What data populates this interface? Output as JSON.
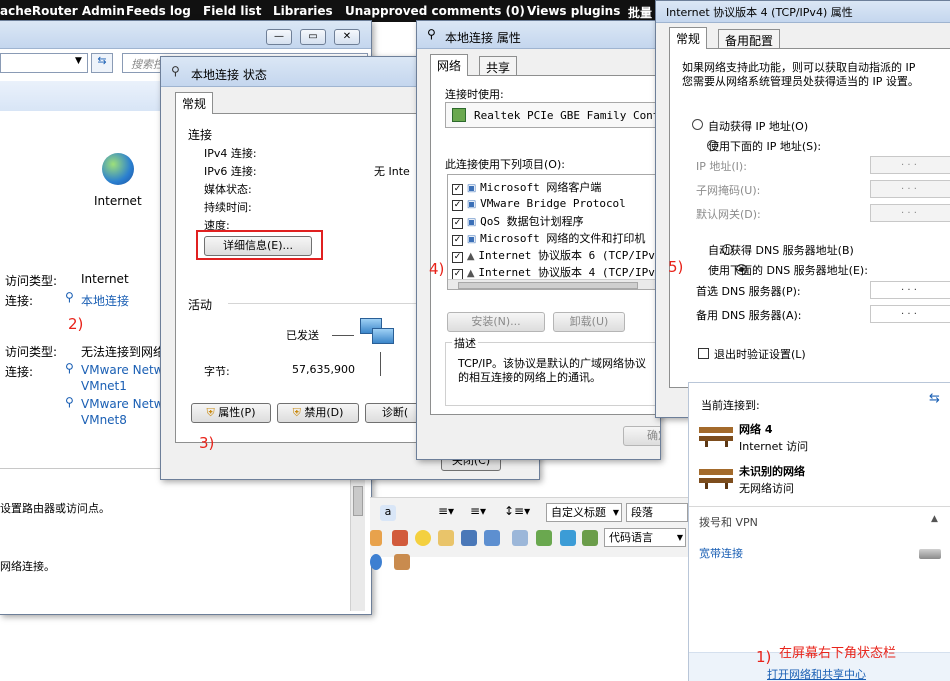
{
  "topbar": {
    "items": [
      "acheRouter Admin",
      "Feeds log",
      "Field list",
      "Libraries",
      "Unapproved comments (0)",
      "Views plugins",
      "批量"
    ]
  },
  "network_window": {
    "search_placeholder": "搜索控...",
    "internet_label": "Internet",
    "conn1": {
      "access_type_label": "访问类型:",
      "access_type_value": "Internet",
      "conn_label": "连接:",
      "conn_value": "本地连接"
    },
    "conn2": {
      "access_type_label": "访问类型:",
      "access_type_value": "无法连接到网络",
      "conn_label": "连接:",
      "conn_values": [
        "VMware Netw",
        "VMnet1",
        "VMware Netw",
        "VMnet8"
      ]
    },
    "hint1": "设置路由器或访问点。",
    "hint2": "网络连接。"
  },
  "status_dialog": {
    "title": "本地连接 状态",
    "tab": "常规",
    "section_connection": "连接",
    "rows": [
      {
        "label": "IPv4 连接:",
        "value": ""
      },
      {
        "label": "IPv6 连接:",
        "value": "无 Inte"
      },
      {
        "label": "媒体状态:",
        "value": ""
      },
      {
        "label": "持续时间:",
        "value": ""
      },
      {
        "label": "速度:",
        "value": ""
      }
    ],
    "details_button": "详细信息(E)...",
    "section_activity": "活动",
    "sent_label": "已发送",
    "bytes_label": "字节:",
    "bytes_value": "57,635,900",
    "properties_button": "属性(P)",
    "disable_button": "禁用(D)",
    "diagnose_button": "诊断(",
    "close_button": "关闭(C)"
  },
  "props_dialog": {
    "title": "本地连接 属性",
    "tabs": [
      "网络",
      "共享"
    ],
    "connect_using_label": "连接时使用:",
    "adapter_name": "Realtek PCIe GBE Family Contro",
    "items_label": "此连接使用下列项目(O):",
    "items": [
      "Microsoft 网络客户端",
      "VMware Bridge Protocol",
      "QoS 数据包计划程序",
      "Microsoft 网络的文件和打印机",
      "Internet 协议版本 6 (TCP/IPv",
      "Internet 协议版本 4 (TCP/IPv"
    ],
    "install_button": "安装(N)...",
    "uninstall_button": "卸载(U)",
    "description_label": "描述",
    "description_text_1": "TCP/IP。该协议是默认的广域网络协议",
    "description_text_2": "的相互连接的网络上的通讯。",
    "ok_button": "确定"
  },
  "ipv4_dialog": {
    "title": "Internet 协议版本 4 (TCP/IPv4) 属性",
    "tabs": [
      "常规",
      "备用配置"
    ],
    "desc_1": "如果网络支持此功能，则可以获取自动指派的 IP",
    "desc_2": "您需要从网络系统管理员处获得适当的 IP 设置。",
    "auto_ip": "自动获得 IP 地址(O)",
    "manual_ip": "使用下面的 IP 地址(S):",
    "ip_address": "IP 地址(I):",
    "subnet_mask": "子网掩码(U):",
    "default_gateway": "默认网关(D):",
    "auto_dns": "自动获得 DNS 服务器地址(B)",
    "manual_dns": "使用下面的 DNS 服务器地址(E):",
    "preferred_dns": "首选 DNS 服务器(P):",
    "alternate_dns": "备用 DNS 服务器(A):",
    "validate_on_exit": "退出时验证设置(L)",
    "ip_dots": ". . ."
  },
  "network_flyout": {
    "currently_connected": "当前连接到:",
    "networks": [
      {
        "name": "网络 4",
        "status": "Internet 访问"
      },
      {
        "name": "未识别的网络",
        "status": "无网络访问"
      }
    ],
    "dialup_vpn": "拨号和 VPN",
    "broadband": "宽带连接",
    "open_center": "打开网络和共享中心"
  },
  "editor_toolbar": {
    "style_select": "自定义标题",
    "paragraph_select": "段落",
    "code_select": "代码语言"
  },
  "annotations": {
    "a1": "1)",
    "a1_text": "在屏幕右下角状态栏",
    "a2": "2)",
    "a3": "3)",
    "a4": "4)",
    "a5": "5)"
  },
  "colors": {
    "annotation_red": "#e8231a",
    "link_blue": "#1a5fb4",
    "highlight_box": "#e02020"
  }
}
